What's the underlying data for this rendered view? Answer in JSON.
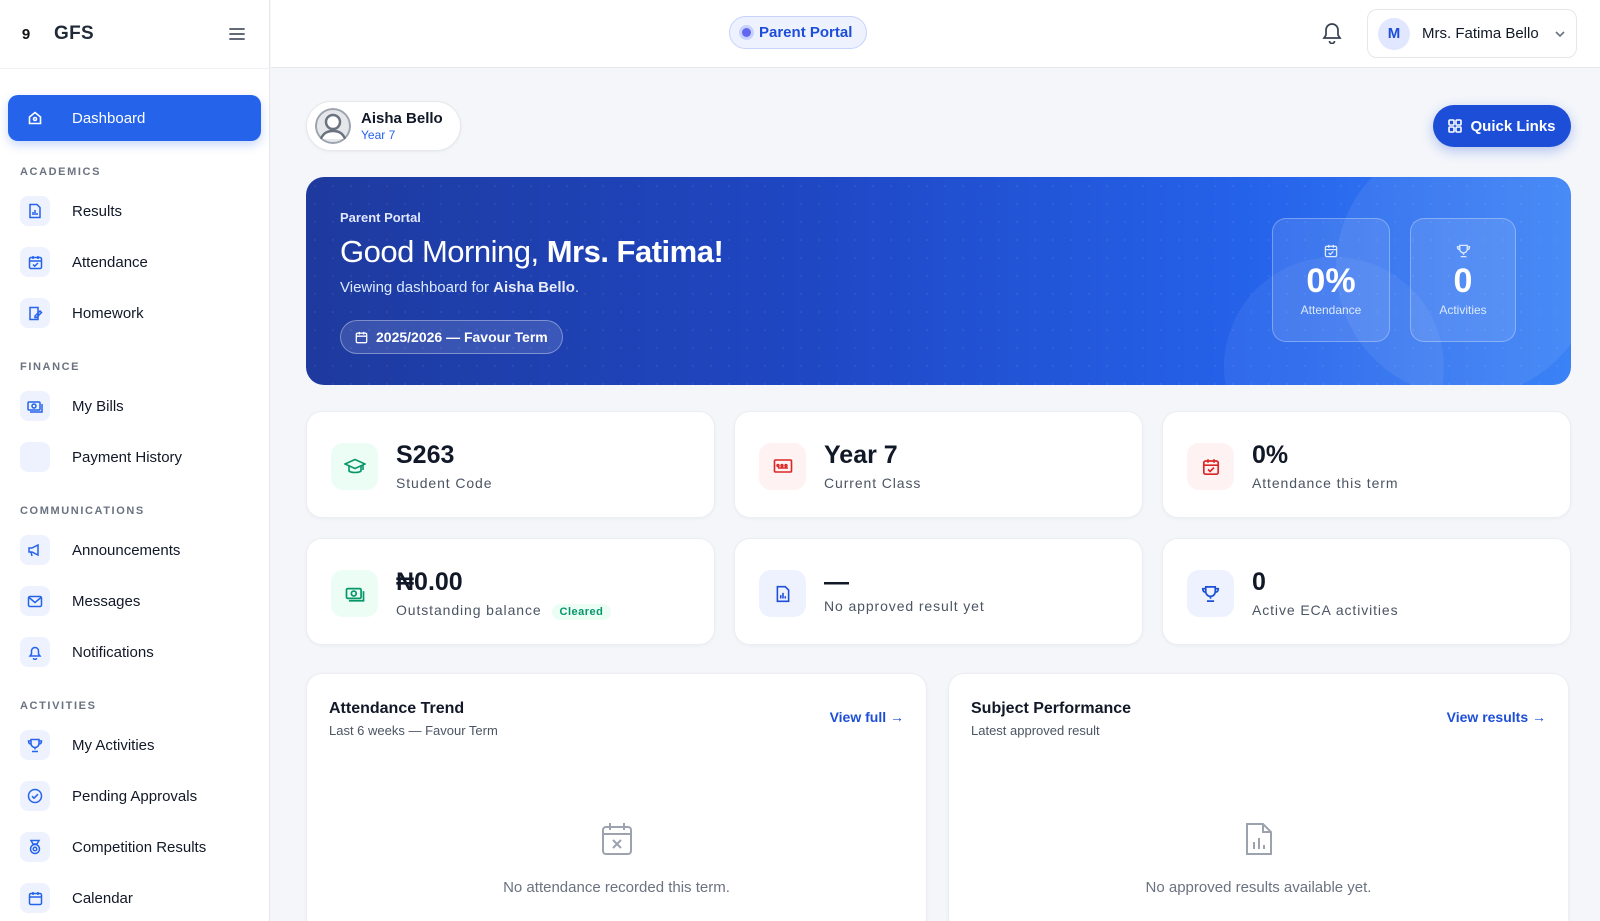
{
  "app": {
    "brand_mark": "9",
    "brand_name": "GFS",
    "portal_label": "Parent Portal"
  },
  "topbar": {
    "user_initial": "M",
    "user_name": "Mrs. Fatima Bello"
  },
  "sidebar": {
    "dashboard": "Dashboard",
    "sections": {
      "academics": "ACADEMICS",
      "finance": "FINANCE",
      "communications": "COMMUNICATIONS",
      "activities": "ACTIVITIES"
    },
    "items": {
      "results": "Results",
      "attendance": "Attendance",
      "homework": "Homework",
      "my_bills": "My Bills",
      "payment_history": "Payment History",
      "announcements": "Announcements",
      "messages": "Messages",
      "notifications": "Notifications",
      "my_activities": "My Activities",
      "pending_approvals": "Pending Approvals",
      "competition_results": "Competition Results",
      "calendar": "Calendar"
    }
  },
  "child": {
    "name": "Aisha Bello",
    "year": "Year 7"
  },
  "quick_links_label": "Quick Links",
  "hero": {
    "kicker": "Parent Portal",
    "greeting_prefix": "Good Morning,",
    "greeting_name": "Mrs. Fatima!",
    "sub_prefix": "Viewing dashboard for",
    "sub_child": "Aisha Bello",
    "sub_suffix": ".",
    "term": "2025/2026 — Favour Term",
    "stats": [
      {
        "value": "0%",
        "label": "Attendance",
        "icon": "calendar-icon"
      },
      {
        "value": "0",
        "label": "Activities",
        "icon": "trophy-icon"
      }
    ]
  },
  "cards": {
    "student_code": {
      "value": "S263",
      "label": "Student Code",
      "icon": "graduation-cap-icon"
    },
    "current_class": {
      "value": "Year 7",
      "label": "Current Class",
      "icon": "class-board-icon"
    },
    "attendance_term": {
      "value": "0%",
      "label": "Attendance this term",
      "icon": "calendar-check-icon"
    },
    "outstanding": {
      "value": "₦0.00",
      "label": "Outstanding balance",
      "badge": "Cleared",
      "icon": "money-icon"
    },
    "result": {
      "value": "—",
      "label": "No approved result yet",
      "icon": "report-icon"
    },
    "eca": {
      "value": "0",
      "label": "Active ECA activities",
      "icon": "trophy-icon"
    }
  },
  "panels": {
    "attendance": {
      "title": "Attendance Trend",
      "subtitle": "Last 6 weeks — Favour Term",
      "link": "View full →",
      "empty": "No attendance recorded this term."
    },
    "performance": {
      "title": "Subject Performance",
      "subtitle": "Latest approved result",
      "link": "View results →",
      "empty": "No approved results available yet."
    }
  },
  "colors": {
    "primary": "#2563eb",
    "primary_dark": "#1d4ed8",
    "success": "#059669",
    "danger": "#dc2626"
  }
}
